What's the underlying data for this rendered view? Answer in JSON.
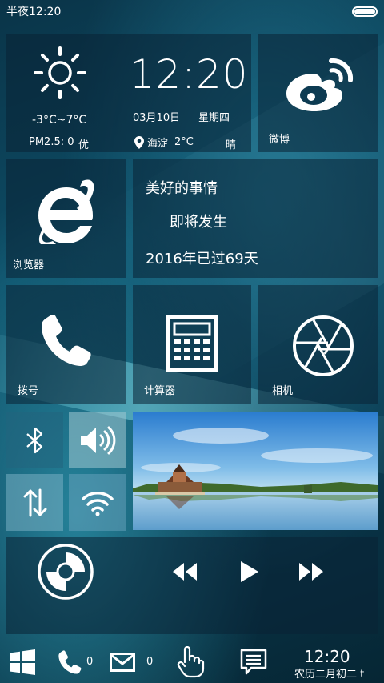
{
  "statusbar": {
    "time": "半夜12:20"
  },
  "clock_tile": {
    "time": "12:20",
    "date": "03月10日",
    "weekday": "星期四",
    "location": "海淀",
    "location_temp": "2°C",
    "condition": "晴",
    "temp_range": "-3°C~7°C",
    "pm25": "PM2.5: 0",
    "air_quality": "优"
  },
  "weibo_tile": {
    "label": "微博"
  },
  "browser_tile": {
    "label": "浏览器"
  },
  "motto_tile": {
    "line1": "美好的事情",
    "line2": "即将发生",
    "line3": "2016年已过69天"
  },
  "dial_tile": {
    "label": "拨号"
  },
  "calculator_tile": {
    "label": "计算器"
  },
  "camera_tile": {
    "label": "相机"
  },
  "taskbar": {
    "missed_calls": "0",
    "unread_mail": "0",
    "time": "12:20",
    "lunar_date": "农历二月初二 t"
  }
}
